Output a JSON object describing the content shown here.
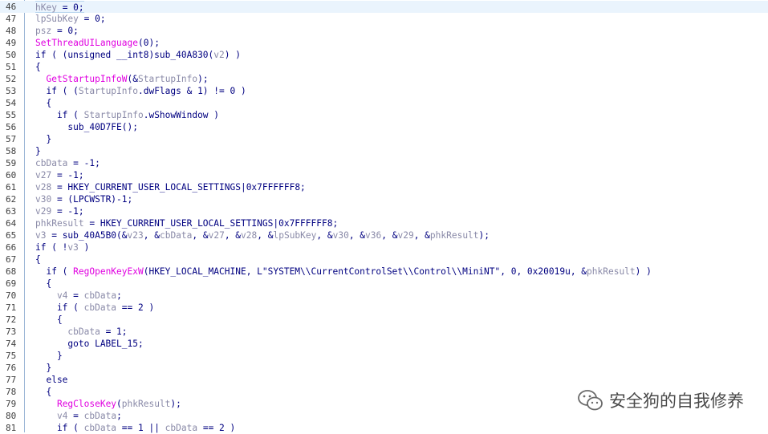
{
  "editor": {
    "lines": [
      {
        "n": "46",
        "t": [
          [
            "v",
            "hKey"
          ],
          [
            "p",
            " = 0;"
          ]
        ]
      },
      {
        "n": "47",
        "t": [
          [
            "v",
            "lpSubKey"
          ],
          [
            "p",
            " = 0;"
          ]
        ]
      },
      {
        "n": "48",
        "t": [
          [
            "v",
            "psz"
          ],
          [
            "p",
            " = 0;"
          ]
        ]
      },
      {
        "n": "49",
        "t": [
          [
            "f",
            "SetThreadUILanguage"
          ],
          [
            "p",
            "(0);"
          ]
        ]
      },
      {
        "n": "50",
        "t": [
          [
            "p",
            "if ( (unsigned __int8)sub_40A830("
          ],
          [
            "v",
            "v2"
          ],
          [
            "p",
            ") )"
          ]
        ]
      },
      {
        "n": "51",
        "t": [
          [
            "p",
            "{"
          ]
        ]
      },
      {
        "n": "52",
        "t": [
          [
            "p",
            "  "
          ],
          [
            "f",
            "GetStartupInfoW"
          ],
          [
            "p",
            "(&"
          ],
          [
            "v",
            "StartupInfo"
          ],
          [
            "p",
            ");"
          ]
        ]
      },
      {
        "n": "53",
        "t": [
          [
            "p",
            "  if ( ("
          ],
          [
            "v",
            "StartupInfo"
          ],
          [
            "p",
            ".dwFlags & 1) != 0 )"
          ]
        ]
      },
      {
        "n": "54",
        "t": [
          [
            "p",
            "  {"
          ]
        ]
      },
      {
        "n": "55",
        "t": [
          [
            "p",
            "    if ( "
          ],
          [
            "v",
            "StartupInfo"
          ],
          [
            "p",
            ".wShowWindow )"
          ]
        ]
      },
      {
        "n": "56",
        "t": [
          [
            "p",
            "      sub_40D7FE();"
          ]
        ]
      },
      {
        "n": "57",
        "t": [
          [
            "p",
            "  }"
          ]
        ]
      },
      {
        "n": "58",
        "t": [
          [
            "p",
            "}"
          ]
        ]
      },
      {
        "n": "59",
        "t": [
          [
            "v",
            "cbData"
          ],
          [
            "p",
            " = -1;"
          ]
        ]
      },
      {
        "n": "60",
        "t": [
          [
            "v",
            "v27"
          ],
          [
            "p",
            " = -1;"
          ]
        ]
      },
      {
        "n": "61",
        "t": [
          [
            "v",
            "v28"
          ],
          [
            "p",
            " = HKEY_CURRENT_USER_LOCAL_SETTINGS|0x7FFFFFF8;"
          ]
        ]
      },
      {
        "n": "62",
        "t": [
          [
            "v",
            "v30"
          ],
          [
            "p",
            " = (LPCWSTR)-1;"
          ]
        ]
      },
      {
        "n": "63",
        "t": [
          [
            "v",
            "v29"
          ],
          [
            "p",
            " = -1;"
          ]
        ]
      },
      {
        "n": "64",
        "t": [
          [
            "v",
            "phkResult"
          ],
          [
            "p",
            " = HKEY_CURRENT_USER_LOCAL_SETTINGS|0x7FFFFFF8;"
          ]
        ]
      },
      {
        "n": "65",
        "t": [
          [
            "v",
            "v3"
          ],
          [
            "p",
            " = sub_40A5B0(&"
          ],
          [
            "v",
            "v23"
          ],
          [
            "p",
            ", &"
          ],
          [
            "v",
            "cbData"
          ],
          [
            "p",
            ", &"
          ],
          [
            "v",
            "v27"
          ],
          [
            "p",
            ", &"
          ],
          [
            "v",
            "v28"
          ],
          [
            "p",
            ", &"
          ],
          [
            "v",
            "lpSubKey"
          ],
          [
            "p",
            ", &"
          ],
          [
            "v",
            "v30"
          ],
          [
            "p",
            ", &"
          ],
          [
            "v",
            "v36"
          ],
          [
            "p",
            ", &"
          ],
          [
            "v",
            "v29"
          ],
          [
            "p",
            ", &"
          ],
          [
            "v",
            "phkResult"
          ],
          [
            "p",
            ");"
          ]
        ]
      },
      {
        "n": "66",
        "t": [
          [
            "p",
            "if ( !"
          ],
          [
            "v",
            "v3"
          ],
          [
            "p",
            " )"
          ]
        ]
      },
      {
        "n": "67",
        "t": [
          [
            "p",
            "{"
          ]
        ]
      },
      {
        "n": "68",
        "t": [
          [
            "p",
            "  if ( "
          ],
          [
            "f",
            "RegOpenKeyExW"
          ],
          [
            "p",
            "(HKEY_LOCAL_MACHINE, L\"SYSTEM\\\\CurrentControlSet\\\\Control\\\\MiniNT\", 0, 0x20019u, &"
          ],
          [
            "v",
            "phkResult"
          ],
          [
            "p",
            ") )"
          ]
        ]
      },
      {
        "n": "69",
        "t": [
          [
            "p",
            "  {"
          ]
        ]
      },
      {
        "n": "70",
        "t": [
          [
            "p",
            "    "
          ],
          [
            "v",
            "v4"
          ],
          [
            "p",
            " = "
          ],
          [
            "v",
            "cbData"
          ],
          [
            "p",
            ";"
          ]
        ]
      },
      {
        "n": "71",
        "t": [
          [
            "p",
            "    if ( "
          ],
          [
            "v",
            "cbData"
          ],
          [
            "p",
            " == 2 )"
          ]
        ]
      },
      {
        "n": "72",
        "t": [
          [
            "p",
            "    {"
          ]
        ]
      },
      {
        "n": "73",
        "t": [
          [
            "p",
            "      "
          ],
          [
            "v",
            "cbData"
          ],
          [
            "p",
            " = 1;"
          ]
        ]
      },
      {
        "n": "74",
        "t": [
          [
            "p",
            "      goto LABEL_15;"
          ]
        ]
      },
      {
        "n": "75",
        "t": [
          [
            "p",
            "    }"
          ]
        ]
      },
      {
        "n": "76",
        "t": [
          [
            "p",
            "  }"
          ]
        ]
      },
      {
        "n": "77",
        "t": [
          [
            "p",
            "  else"
          ]
        ]
      },
      {
        "n": "78",
        "t": [
          [
            "p",
            "  {"
          ]
        ]
      },
      {
        "n": "79",
        "t": [
          [
            "p",
            "    "
          ],
          [
            "f",
            "RegCloseKey"
          ],
          [
            "p",
            "("
          ],
          [
            "v",
            "phkResult"
          ],
          [
            "p",
            ");"
          ]
        ]
      },
      {
        "n": "80",
        "t": [
          [
            "p",
            "    "
          ],
          [
            "v",
            "v4"
          ],
          [
            "p",
            " = "
          ],
          [
            "v",
            "cbData"
          ],
          [
            "p",
            ";"
          ]
        ]
      },
      {
        "n": "81",
        "t": [
          [
            "p",
            "    if ( "
          ],
          [
            "v",
            "cbData"
          ],
          [
            "p",
            " == 1 || "
          ],
          [
            "v",
            "cbData"
          ],
          [
            "p",
            " == 2 )"
          ]
        ]
      }
    ]
  },
  "watermark": {
    "text": "安全狗的自我修养",
    "icon": "wechat-icon"
  },
  "colors": {
    "variable": "#8a8aa8",
    "function": "#e000e0",
    "plain": "#000080",
    "current_line": "#eaf4fd"
  }
}
